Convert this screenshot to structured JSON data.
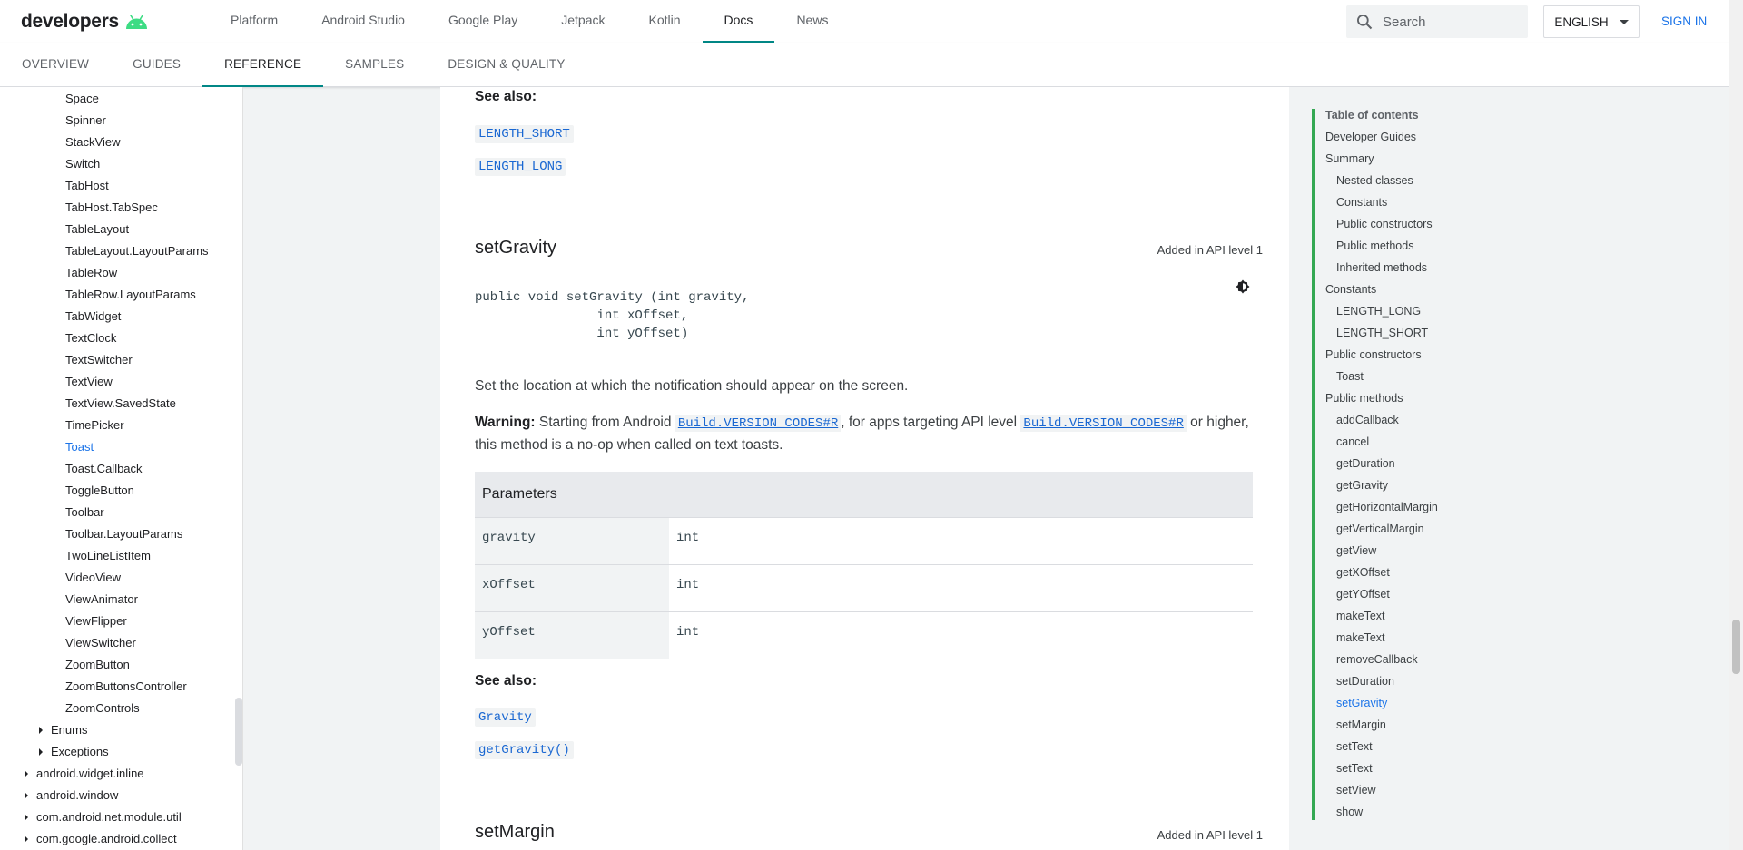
{
  "header": {
    "logo": "developers",
    "nav": [
      "Platform",
      "Android Studio",
      "Google Play",
      "Jetpack",
      "Kotlin",
      "Docs",
      "News"
    ],
    "active_nav": "Docs",
    "search_placeholder": "Search",
    "language": "ENGLISH",
    "sign_in": "SIGN IN",
    "brand_color": "#3ddc84",
    "accent_color": "#018786",
    "link_color": "#1a73e8"
  },
  "subnav": {
    "tabs": [
      "OVERVIEW",
      "GUIDES",
      "REFERENCE",
      "SAMPLES",
      "DESIGN & QUALITY"
    ],
    "active": "REFERENCE"
  },
  "leftnav": {
    "items": [
      "Space",
      "Spinner",
      "StackView",
      "Switch",
      "TabHost",
      "TabHost.TabSpec",
      "TableLayout",
      "TableLayout.LayoutParams",
      "TableRow",
      "TableRow.LayoutParams",
      "TabWidget",
      "TextClock",
      "TextSwitcher",
      "TextView",
      "TextView.SavedState",
      "TimePicker",
      "Toast",
      "Toast.Callback",
      "ToggleButton",
      "Toolbar",
      "Toolbar.LayoutParams",
      "TwoLineListItem",
      "VideoView",
      "ViewAnimator",
      "ViewFlipper",
      "ViewSwitcher",
      "ZoomButton",
      "ZoomButtonsController",
      "ZoomControls"
    ],
    "active": "Toast",
    "groups": [
      "Enums",
      "Exceptions"
    ],
    "packages": [
      "android.widget.inline",
      "android.window",
      "com.android.net.module.util",
      "com.google.android.collect"
    ]
  },
  "content": {
    "see_also_1": {
      "label": "See also:",
      "links": [
        "LENGTH_SHORT",
        "LENGTH_LONG"
      ]
    },
    "method": {
      "name": "setGravity",
      "added": "Added in API level 1",
      "signature": "public void setGravity (int gravity, \n                int xOffset, \n                int yOffset)",
      "description": "Set the location at which the notification should appear on the screen.",
      "warning_label": "Warning:",
      "warning_pre": " Starting from Android ",
      "warning_link1": "Build.VERSION_CODES#R",
      "warning_mid": ", for apps targeting API level ",
      "warning_link2": "Build.VERSION_CODES#R",
      "warning_post": " or higher, this method is a no-op when called on text toasts.",
      "params_header": "Parameters",
      "params": [
        {
          "name": "gravity",
          "type": "int"
        },
        {
          "name": "xOffset",
          "type": "int"
        },
        {
          "name": "yOffset",
          "type": "int"
        }
      ]
    },
    "see_also_2": {
      "label": "See also:",
      "links": [
        "Gravity",
        "getGravity()"
      ]
    },
    "next_method": {
      "name": "setMargin",
      "added": "Added in API level 1"
    }
  },
  "toc": {
    "title": "Table of contents",
    "items": [
      {
        "label": "Developer Guides",
        "level": 0
      },
      {
        "label": "Summary",
        "level": 0
      },
      {
        "label": "Nested classes",
        "level": 1
      },
      {
        "label": "Constants",
        "level": 1
      },
      {
        "label": "Public constructors",
        "level": 1
      },
      {
        "label": "Public methods",
        "level": 1
      },
      {
        "label": "Inherited methods",
        "level": 1
      },
      {
        "label": "Constants",
        "level": 0
      },
      {
        "label": "LENGTH_LONG",
        "level": 1
      },
      {
        "label": "LENGTH_SHORT",
        "level": 1
      },
      {
        "label": "Public constructors",
        "level": 0
      },
      {
        "label": "Toast",
        "level": 1
      },
      {
        "label": "Public methods",
        "level": 0
      },
      {
        "label": "addCallback",
        "level": 1
      },
      {
        "label": "cancel",
        "level": 1
      },
      {
        "label": "getDuration",
        "level": 1
      },
      {
        "label": "getGravity",
        "level": 1
      },
      {
        "label": "getHorizontalMargin",
        "level": 1
      },
      {
        "label": "getVerticalMargin",
        "level": 1
      },
      {
        "label": "getView",
        "level": 1
      },
      {
        "label": "getXOffset",
        "level": 1
      },
      {
        "label": "getYOffset",
        "level": 1
      },
      {
        "label": "makeText",
        "level": 1
      },
      {
        "label": "makeText",
        "level": 1
      },
      {
        "label": "removeCallback",
        "level": 1
      },
      {
        "label": "setDuration",
        "level": 1
      },
      {
        "label": "setGravity",
        "level": 1
      },
      {
        "label": "setMargin",
        "level": 1
      },
      {
        "label": "setText",
        "level": 1
      },
      {
        "label": "setText",
        "level": 1
      },
      {
        "label": "setView",
        "level": 1
      },
      {
        "label": "show",
        "level": 1
      }
    ],
    "active": "setGravity"
  }
}
